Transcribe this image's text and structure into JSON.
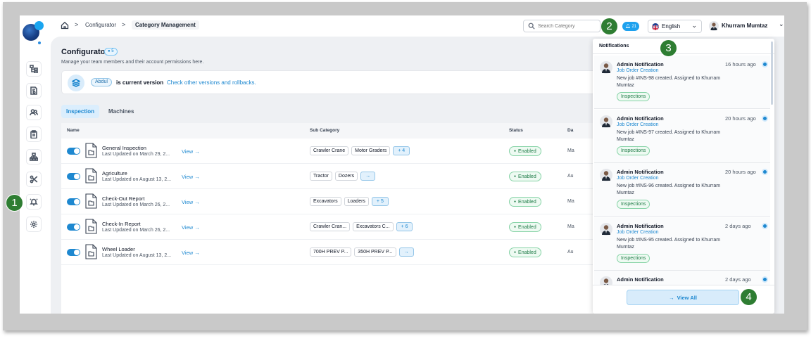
{
  "breadcrumb": {
    "item1": "Configurator",
    "item2": "Category Management"
  },
  "search": {
    "placeholder": "Search Category"
  },
  "notifications_badge": {
    "count": "21"
  },
  "language": {
    "label": "English"
  },
  "user": {
    "name": "Khurram Mumtaz"
  },
  "page": {
    "title": "Configurator",
    "badge": "5",
    "subtitle": "Manage your team members and their account permissions here."
  },
  "version": {
    "chip": "Abdul",
    "text": "is current version",
    "link": "Check other versions and rollbacks."
  },
  "tabs": [
    {
      "label": "Inspection"
    },
    {
      "label": "Machines"
    }
  ],
  "table": {
    "headers": {
      "name": "Name",
      "subcategory": "Sub Category",
      "status": "Status",
      "date": "Da"
    },
    "rows": [
      {
        "name": "General Inspection",
        "updated": "Last Updated on March 29, 2...",
        "view": "View →",
        "chips": [
          "Crawler Crane",
          "Motor Graders"
        ],
        "more": "+ 4",
        "status": "Enabled",
        "date": "Ma"
      },
      {
        "name": "Agriculture",
        "updated": "Last Updated on August 13, 2...",
        "view": "View →",
        "chips": [
          "Tractor",
          "Dozers"
        ],
        "more": "→",
        "status": "Enabled",
        "date": "Au"
      },
      {
        "name": "Check-Out Report",
        "updated": "Last Updated on March 26, 2...",
        "view": "View →",
        "chips": [
          "Excavators",
          "Loaders"
        ],
        "more": "+ 5",
        "status": "Enabled",
        "date": "Ma"
      },
      {
        "name": "Check-In Report",
        "updated": "Last Updated on March 26, 2...",
        "view": "View →",
        "chips": [
          "Crawler Cran...",
          "Excavators C..."
        ],
        "more": "+ 6",
        "status": "Enabled",
        "date": "Ma"
      },
      {
        "name": "Wheel Loader",
        "updated": "Last Updated on August 13, 2...",
        "view": "View →",
        "chips": [
          "700H PREV P...",
          "350H PREV P..."
        ],
        "more": "→",
        "status": "Enabled",
        "date": "Au"
      }
    ]
  },
  "notifications": {
    "title": "Notifications",
    "items": [
      {
        "title": "Admin Notification",
        "time": "16 hours ago",
        "link": "Job Order Creation",
        "body": "New job #INS-98 created. Assigned to Khurram Mumtaz",
        "tag": "Inspections"
      },
      {
        "title": "Admin Notification",
        "time": "20 hours ago",
        "link": "Job Order Creation",
        "body": "New job #INS-97 created. Assigned to Khurram Mumtaz",
        "tag": "Inspections"
      },
      {
        "title": "Admin Notification",
        "time": "20 hours ago",
        "link": "Job Order Creation",
        "body": "New job #INS-96 created. Assigned to Khurram Mumtaz",
        "tag": "Inspections"
      },
      {
        "title": "Admin Notification",
        "time": "2 days ago",
        "link": "Job Order Creation",
        "body": "New job #INS-95 created. Assigned to Khurram Mumtaz",
        "tag": "Inspections"
      },
      {
        "title": "Admin Notification",
        "time": "2 days ago"
      }
    ],
    "view_all": "View All"
  },
  "callouts": [
    "1",
    "2",
    "3",
    "4"
  ],
  "colors": {
    "accent": "#1e88d0",
    "callout": "#2e7d32",
    "enabled": "#1c7a45"
  }
}
